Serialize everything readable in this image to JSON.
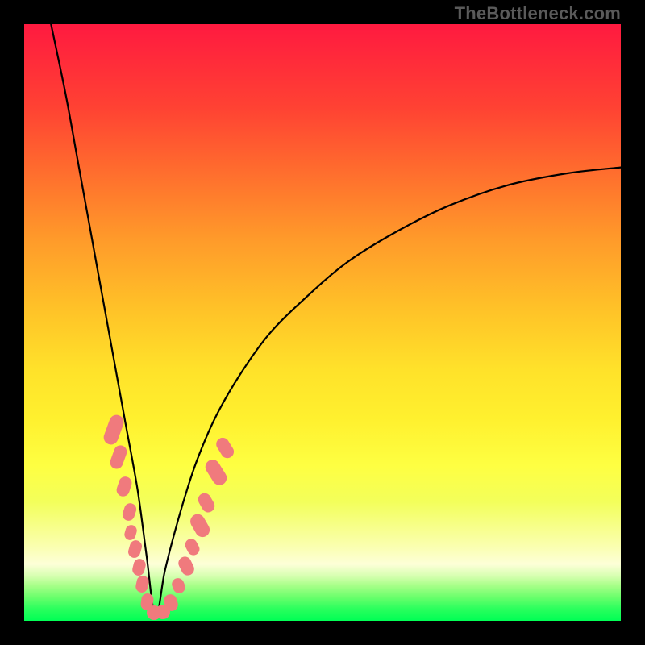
{
  "attribution": "TheBottleneck.com",
  "colors": {
    "frame": "#000000",
    "curve": "#000000",
    "marker": "#f07a7d",
    "gradient_top": "#ff1a40",
    "gradient_bottom": "#00ff55"
  },
  "chart_data": {
    "type": "line",
    "title": "",
    "xlabel": "",
    "ylabel": "",
    "xlim": [
      0,
      100
    ],
    "ylim": [
      0,
      100
    ],
    "notes": "Axes unlabeled; values are visual estimates in percent of plot area. Curve is V-shaped with minimum at x≈22 reaching y≈0, left branch exits top at x≈4.5, right branch rises to y≈76 at x=100.",
    "series": [
      {
        "name": "bottleneck-curve",
        "x": [
          4.5,
          7,
          9,
          11,
          13,
          15,
          17,
          19,
          20.5,
          22,
          23.5,
          25,
          27,
          29,
          32,
          36,
          41,
          47,
          54,
          62,
          71,
          81,
          91,
          100
        ],
        "y": [
          100,
          88,
          77,
          66,
          55,
          44,
          33,
          22,
          11,
          0.5,
          8,
          14,
          21,
          27,
          34,
          41,
          48,
          54,
          60,
          65,
          69.5,
          73,
          75,
          76
        ]
      }
    ],
    "markers": {
      "name": "overlay-dots",
      "description": "Salmon rounded markers clustered along lower portion of both branches near the minimum.",
      "points": [
        {
          "x": 15.0,
          "y": 32.0,
          "w": 2.4,
          "h": 5.2,
          "rot": 20
        },
        {
          "x": 15.8,
          "y": 27.5,
          "w": 2.2,
          "h": 4.0,
          "rot": 20
        },
        {
          "x": 16.8,
          "y": 22.5,
          "w": 2.2,
          "h": 3.4,
          "rot": 18
        },
        {
          "x": 17.6,
          "y": 18.2,
          "w": 2.0,
          "h": 3.0,
          "rot": 18
        },
        {
          "x": 17.9,
          "y": 14.8,
          "w": 1.9,
          "h": 2.6,
          "rot": 16
        },
        {
          "x": 18.6,
          "y": 12.0,
          "w": 2.0,
          "h": 3.0,
          "rot": 16
        },
        {
          "x": 19.2,
          "y": 9.0,
          "w": 2.0,
          "h": 2.8,
          "rot": 14
        },
        {
          "x": 19.8,
          "y": 6.2,
          "w": 2.0,
          "h": 2.8,
          "rot": 12
        },
        {
          "x": 20.6,
          "y": 3.2,
          "w": 2.0,
          "h": 2.8,
          "rot": 8
        },
        {
          "x": 21.8,
          "y": 1.4,
          "w": 2.4,
          "h": 2.4,
          "rot": 0
        },
        {
          "x": 23.2,
          "y": 1.5,
          "w": 2.4,
          "h": 2.4,
          "rot": 0
        },
        {
          "x": 24.6,
          "y": 3.0,
          "w": 2.2,
          "h": 2.8,
          "rot": -18
        },
        {
          "x": 25.8,
          "y": 5.8,
          "w": 2.0,
          "h": 2.6,
          "rot": -22
        },
        {
          "x": 27.2,
          "y": 9.2,
          "w": 2.2,
          "h": 3.2,
          "rot": -26
        },
        {
          "x": 28.2,
          "y": 12.4,
          "w": 2.0,
          "h": 2.8,
          "rot": -28
        },
        {
          "x": 29.4,
          "y": 16.0,
          "w": 2.4,
          "h": 4.0,
          "rot": -30
        },
        {
          "x": 30.6,
          "y": 19.8,
          "w": 2.2,
          "h": 3.4,
          "rot": -30
        },
        {
          "x": 32.2,
          "y": 24.8,
          "w": 2.4,
          "h": 4.6,
          "rot": -32
        },
        {
          "x": 33.6,
          "y": 29.0,
          "w": 2.2,
          "h": 3.6,
          "rot": -32
        }
      ]
    }
  }
}
